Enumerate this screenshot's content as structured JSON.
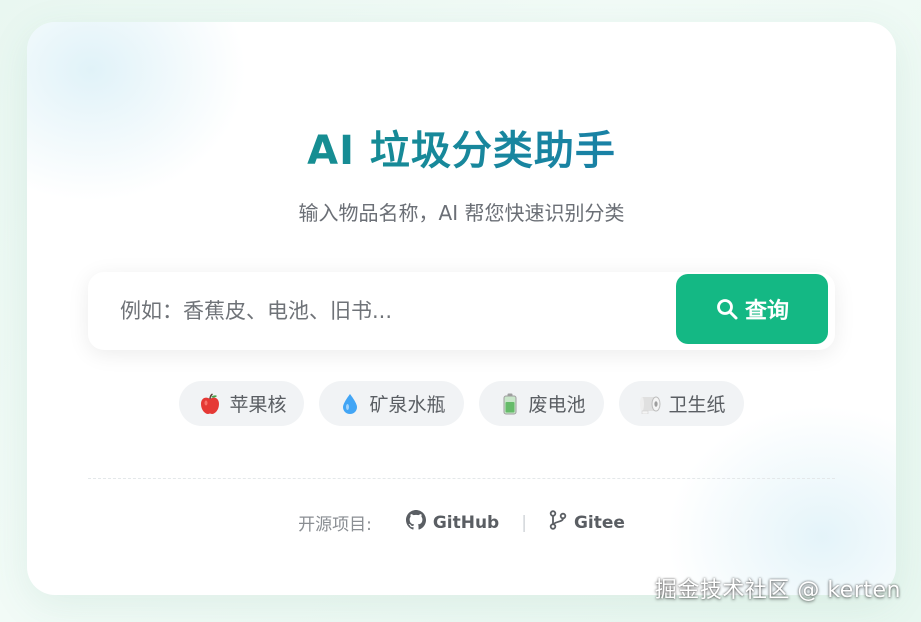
{
  "header": {
    "title": "AI 垃圾分类助手",
    "subtitle": "输入物品名称，AI 帮您快速识别分类"
  },
  "search": {
    "placeholder": "例如：香蕉皮、电池、旧书...",
    "value": "",
    "button_label": "查询",
    "button_icon": "search-icon",
    "button_color": "#14b884"
  },
  "examples": [
    {
      "label": "苹果核",
      "icon": "apple-icon"
    },
    {
      "label": "矿泉水瓶",
      "icon": "water-drop-icon"
    },
    {
      "label": "废电池",
      "icon": "battery-icon"
    },
    {
      "label": "卫生纸",
      "icon": "toilet-paper-icon"
    }
  ],
  "footer": {
    "label": "开源项目:",
    "links": [
      {
        "label": "GitHub",
        "icon": "github-icon"
      },
      {
        "label": "Gitee",
        "icon": "git-branch-icon"
      }
    ],
    "separator": "|"
  },
  "watermark": "掘金技术社区 @ kerten",
  "colors": {
    "accent": "#14b884",
    "title_gradient_start": "#129a7f",
    "title_gradient_end": "#1d75b8"
  }
}
